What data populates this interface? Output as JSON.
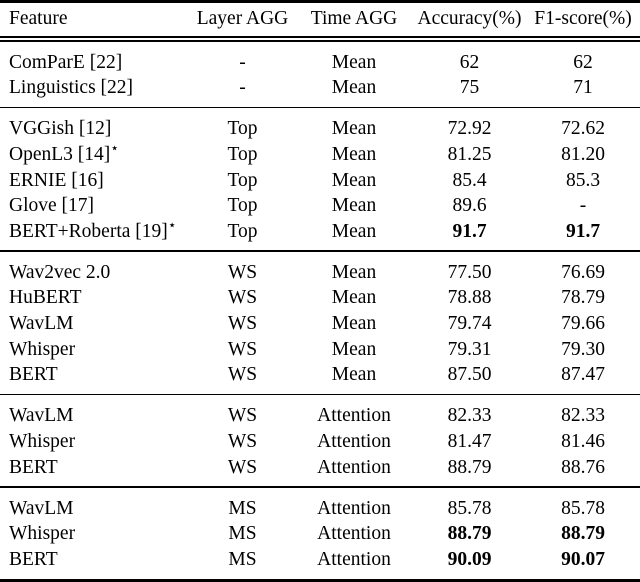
{
  "table": {
    "columns": [
      {
        "key": "feature",
        "label": "Feature",
        "align": "left"
      },
      {
        "key": "layer_agg",
        "label": "Layer AGG",
        "align": "center"
      },
      {
        "key": "time_agg",
        "label": "Time AGG",
        "align": "center"
      },
      {
        "key": "accuracy",
        "label": "Accuracy(%)",
        "align": "center"
      },
      {
        "key": "f1",
        "label": "F1-score(%)",
        "align": "center"
      }
    ],
    "groups": [
      {
        "id": "group-baselines",
        "rows": [
          {
            "feature": "ComParE [22]",
            "feature_star": false,
            "layer_agg": "-",
            "time_agg": "Mean",
            "accuracy": "62",
            "f1": "62",
            "accuracy_bold": false,
            "f1_bold": false
          },
          {
            "feature": "Linguistics [22]",
            "feature_star": false,
            "layer_agg": "-",
            "time_agg": "Mean",
            "accuracy": "75",
            "f1": "71",
            "accuracy_bold": false,
            "f1_bold": false
          }
        ]
      },
      {
        "id": "group-top-mean",
        "rows": [
          {
            "feature": "VGGish [12]",
            "feature_star": false,
            "layer_agg": "Top",
            "time_agg": "Mean",
            "accuracy": "72.92",
            "f1": "72.62",
            "accuracy_bold": false,
            "f1_bold": false
          },
          {
            "feature": "OpenL3 [14]",
            "feature_star": true,
            "layer_agg": "Top",
            "time_agg": "Mean",
            "accuracy": "81.25",
            "f1": "81.20",
            "accuracy_bold": false,
            "f1_bold": false
          },
          {
            "feature": "ERNIE [16]",
            "feature_star": false,
            "layer_agg": "Top",
            "time_agg": "Mean",
            "accuracy": "85.4",
            "f1": "85.3",
            "accuracy_bold": false,
            "f1_bold": false
          },
          {
            "feature": "Glove [17]",
            "feature_star": false,
            "layer_agg": "Top",
            "time_agg": "Mean",
            "accuracy": "89.6",
            "f1": "-",
            "accuracy_bold": false,
            "f1_bold": false
          },
          {
            "feature": "BERT+Roberta [19]",
            "feature_star": true,
            "layer_agg": "Top",
            "time_agg": "Mean",
            "accuracy": "91.7",
            "f1": "91.7",
            "accuracy_bold": true,
            "f1_bold": true
          }
        ]
      },
      {
        "id": "group-ws-mean",
        "rows": [
          {
            "feature": "Wav2vec 2.0",
            "feature_star": false,
            "layer_agg": "WS",
            "time_agg": "Mean",
            "accuracy": "77.50",
            "f1": "76.69",
            "accuracy_bold": false,
            "f1_bold": false
          },
          {
            "feature": "HuBERT",
            "feature_star": false,
            "layer_agg": "WS",
            "time_agg": "Mean",
            "accuracy": "78.88",
            "f1": "78.79",
            "accuracy_bold": false,
            "f1_bold": false
          },
          {
            "feature": "WavLM",
            "feature_star": false,
            "layer_agg": "WS",
            "time_agg": "Mean",
            "accuracy": "79.74",
            "f1": "79.66",
            "accuracy_bold": false,
            "f1_bold": false
          },
          {
            "feature": "Whisper",
            "feature_star": false,
            "layer_agg": "WS",
            "time_agg": "Mean",
            "accuracy": "79.31",
            "f1": "79.30",
            "accuracy_bold": false,
            "f1_bold": false
          },
          {
            "feature": "BERT",
            "feature_star": false,
            "layer_agg": "WS",
            "time_agg": "Mean",
            "accuracy": "87.50",
            "f1": "87.47",
            "accuracy_bold": false,
            "f1_bold": false
          }
        ]
      },
      {
        "id": "group-ws-attention",
        "rows": [
          {
            "feature": "WavLM",
            "feature_star": false,
            "layer_agg": "WS",
            "time_agg": "Attention",
            "accuracy": "82.33",
            "f1": "82.33",
            "accuracy_bold": false,
            "f1_bold": false
          },
          {
            "feature": "Whisper",
            "feature_star": false,
            "layer_agg": "WS",
            "time_agg": "Attention",
            "accuracy": "81.47",
            "f1": "81.46",
            "accuracy_bold": false,
            "f1_bold": false
          },
          {
            "feature": "BERT",
            "feature_star": false,
            "layer_agg": "WS",
            "time_agg": "Attention",
            "accuracy": "88.79",
            "f1": "88.76",
            "accuracy_bold": false,
            "f1_bold": false
          }
        ]
      },
      {
        "id": "group-ms-attention",
        "rows": [
          {
            "feature": "WavLM",
            "feature_star": false,
            "layer_agg": "MS",
            "time_agg": "Attention",
            "accuracy": "85.78",
            "f1": "85.78",
            "accuracy_bold": false,
            "f1_bold": false
          },
          {
            "feature": "Whisper",
            "feature_star": false,
            "layer_agg": "MS",
            "time_agg": "Attention",
            "accuracy": "88.79",
            "f1": "88.79",
            "accuracy_bold": true,
            "f1_bold": true
          },
          {
            "feature": "BERT",
            "feature_star": false,
            "layer_agg": "MS",
            "time_agg": "Attention",
            "accuracy": "90.09",
            "f1": "90.07",
            "accuracy_bold": true,
            "f1_bold": true
          }
        ]
      }
    ],
    "star_glyph": "⋆"
  }
}
